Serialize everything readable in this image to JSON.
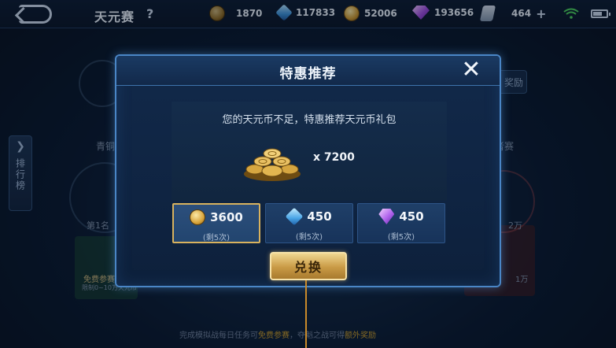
{
  "topbar": {
    "title": "天元赛",
    "help": "?",
    "resources": [
      {
        "icon": "medal-coin-icon",
        "value": "1870"
      },
      {
        "icon": "blue-crystal-icon",
        "value": "117833"
      },
      {
        "icon": "gold-coin-icon",
        "value": "52006"
      },
      {
        "icon": "purple-gem-icon",
        "value": "193656"
      },
      {
        "icon": "ticket-icon",
        "value": "464"
      }
    ],
    "plus": "+"
  },
  "background": {
    "side_tab_label": "排行榜",
    "left_label": "青铜赛",
    "right_label": "王者赛",
    "rank_label": "第1名",
    "right_value": "2万",
    "free_entry": "免费参赛",
    "limit_text": "限制0~10万天元币",
    "right_bottom": "1万",
    "reward_btn": "奖励",
    "bottom_hint_prefix": "完成模拟战每日任务可",
    "bottom_hint_mid": "免费参赛",
    "bottom_hint_mid2": "，夺魁之战可得",
    "bottom_hint_suffix": "额外奖励"
  },
  "modal": {
    "title": "特惠推荐",
    "close": "✕",
    "message": "您的天元币不足，特惠推荐天元币礼包",
    "quantity": "x 7200",
    "options": [
      {
        "icon": "gold-coin-icon",
        "price": "3600",
        "remain": "(剩5次)",
        "selected": true
      },
      {
        "icon": "diamond-icon",
        "price": "450",
        "remain": "(剩5次)",
        "selected": false
      },
      {
        "icon": "purple-gem-icon",
        "price": "450",
        "remain": "(剩5次)",
        "selected": false
      }
    ],
    "exchange_label": "兑换"
  },
  "colors": {
    "accent_gold": "#d8b25e",
    "modal_border": "#4a86c6",
    "pointer": "#c98a2a"
  }
}
